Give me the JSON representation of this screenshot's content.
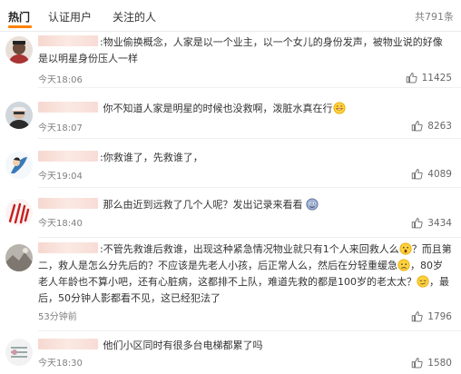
{
  "tabs": [
    {
      "label": "热门",
      "active": true
    },
    {
      "label": "认证用户",
      "active": false
    },
    {
      "label": "关注的人",
      "active": false
    }
  ],
  "total_count": "共791条",
  "comments": [
    {
      "text": ":物业偷换概念，人家是以一个业主，以一个女儿的身份发声，被物业说的好像是以明星身份压人一样",
      "time": "今天18:06",
      "likes": "11425"
    },
    {
      "text": "你不知道人家是明星的时候也没救啊，泼脏水真在行",
      "time": "今天18:07",
      "likes": "8263",
      "emoji": "grin"
    },
    {
      "text": ":你救谁了，先救谁了，",
      "time": "今天19:04",
      "likes": "4089"
    },
    {
      "text": "那么由近到远救了几个人呢？发出记录来看看",
      "time": "今天18:40",
      "likes": "3434",
      "emoji": "sly"
    },
    {
      "text_parts": [
        ":不管先救谁后救谁，出现这种紧急情况物业就只有1个人来回救人么",
        "？而且第二，救人是怎么分先后的？不应该是先老人小孩，后正常人么，然后在分轻重缓急",
        "，80岁老人年龄也不算小吧，还有心脏病，这都排不上队，难道先救的都是100岁的老太太？",
        "，最后，50分钟人影都看不见，这已经犯法了"
      ],
      "time": "53分钟前",
      "likes": "1796"
    },
    {
      "text": "他们小区同时有很多台电梯都累了吗",
      "time": "今天18:30",
      "likes": "1580"
    }
  ],
  "colors": {
    "accent": "#ff8200",
    "meta": "#808080",
    "text": "#333333"
  },
  "icons": {
    "like": "thumbs-up-icon"
  }
}
